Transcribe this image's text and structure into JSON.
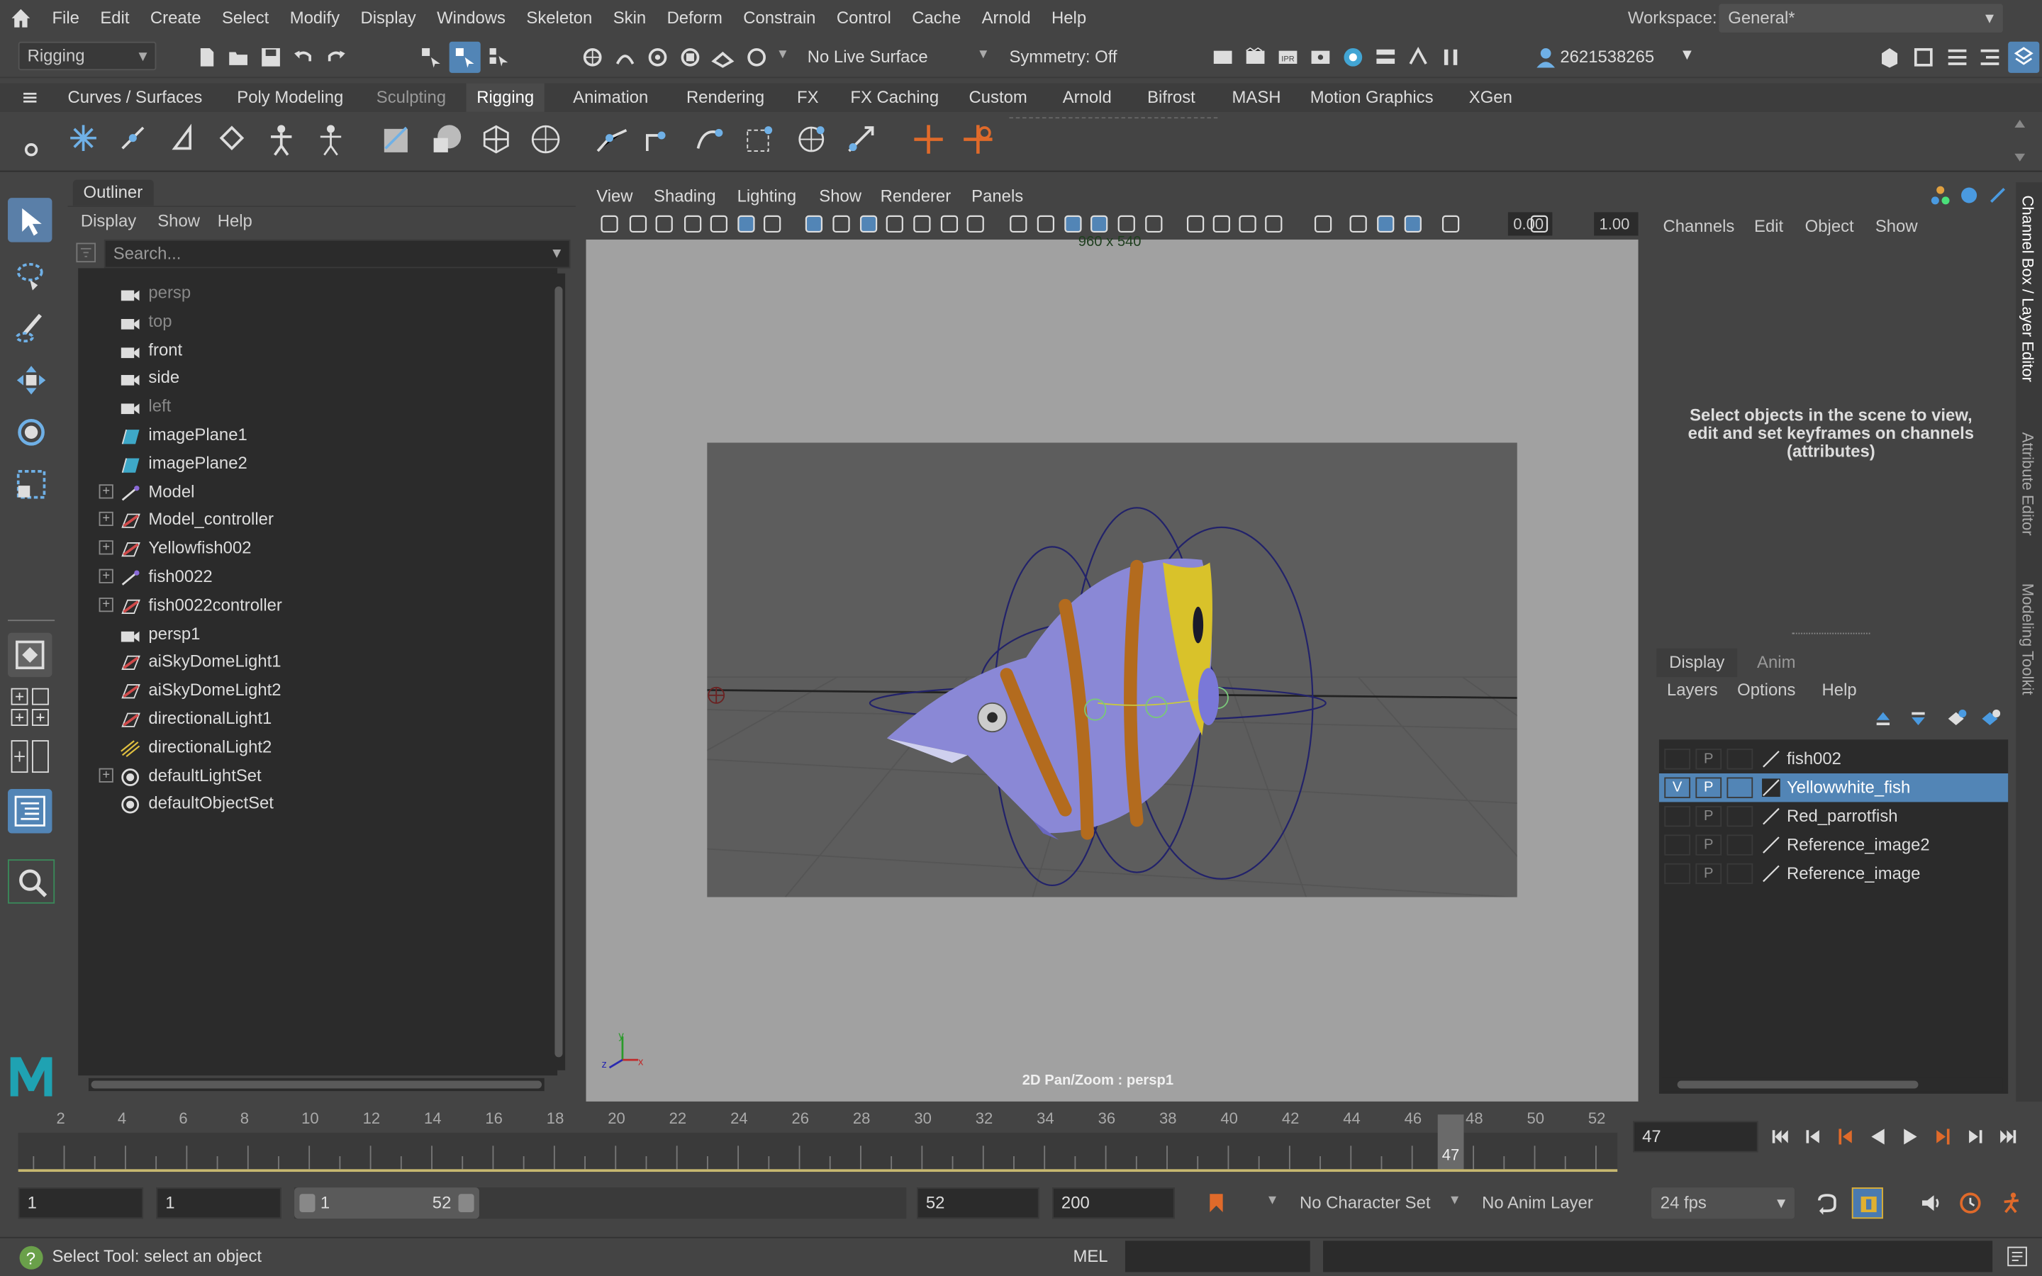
{
  "menubar": {
    "items": [
      "File",
      "Edit",
      "Create",
      "Select",
      "Modify",
      "Display",
      "Windows",
      "Skeleton",
      "Skin",
      "Deform",
      "Constrain",
      "Control",
      "Cache",
      "Arnold",
      "Help"
    ],
    "workspace_label": "Workspace:",
    "workspace_value": "General*"
  },
  "toolbar": {
    "mode": "Rigging",
    "live_surface": "No Live Surface",
    "symmetry": "Symmetry: Off",
    "user_id": "2621538265"
  },
  "shelf": {
    "tabs": [
      "Curves / Surfaces",
      "Poly Modeling",
      "Sculpting",
      "Rigging",
      "Animation",
      "Rendering",
      "FX",
      "FX Caching",
      "Custom",
      "Arnold",
      "Bifrost",
      "MASH",
      "Motion Graphics",
      "XGen"
    ],
    "active_tab": "Rigging"
  },
  "outliner": {
    "title": "Outliner",
    "menu": [
      "Display",
      "Show",
      "Help"
    ],
    "search_placeholder": "Search...",
    "items": [
      {
        "label": "persp",
        "icon": "camera-icon",
        "expandable": false,
        "grey": true
      },
      {
        "label": "top",
        "icon": "camera-icon",
        "expandable": false,
        "grey": true
      },
      {
        "label": "front",
        "icon": "camera-icon",
        "expandable": false,
        "grey": false
      },
      {
        "label": "side",
        "icon": "camera-icon",
        "expandable": false,
        "grey": false
      },
      {
        "label": "left",
        "icon": "camera-icon",
        "expandable": false,
        "grey": true
      },
      {
        "label": "imagePlane1",
        "icon": "image-plane-icon",
        "expandable": false,
        "grey": false
      },
      {
        "label": "imagePlane2",
        "icon": "image-plane-icon",
        "expandable": false,
        "grey": false
      },
      {
        "label": "Model",
        "icon": "joint-icon",
        "expandable": true,
        "grey": false
      },
      {
        "label": "Model_controller",
        "icon": "curve-icon",
        "expandable": true,
        "grey": false
      },
      {
        "label": "Yellowfish002",
        "icon": "curve-icon",
        "expandable": true,
        "grey": false
      },
      {
        "label": "fish0022",
        "icon": "joint-icon",
        "expandable": true,
        "grey": false
      },
      {
        "label": "fish0022controller",
        "icon": "curve-icon",
        "expandable": true,
        "grey": false
      },
      {
        "label": "persp1",
        "icon": "camera-icon",
        "expandable": false,
        "grey": false
      },
      {
        "label": "aiSkyDomeLight1",
        "icon": "curve-icon",
        "expandable": false,
        "grey": false
      },
      {
        "label": "aiSkyDomeLight2",
        "icon": "curve-icon",
        "expandable": false,
        "grey": false
      },
      {
        "label": "directionalLight1",
        "icon": "curve-icon",
        "expandable": false,
        "grey": false
      },
      {
        "label": "directionalLight2",
        "icon": "directional-light-icon",
        "expandable": false,
        "grey": false
      },
      {
        "label": "defaultLightSet",
        "icon": "set-icon",
        "expandable": true,
        "grey": false
      },
      {
        "label": "defaultObjectSet",
        "icon": "set-icon",
        "expandable": false,
        "grey": false
      }
    ]
  },
  "viewport": {
    "menu": [
      "View",
      "Shading",
      "Lighting",
      "Show",
      "Renderer",
      "Panels"
    ],
    "resolution": "960 x 540",
    "exposure": "0.00",
    "gamma": "1.00",
    "camera_label": "2D Pan/Zoom : persp1"
  },
  "channelbox": {
    "menu": [
      "Channels",
      "Edit",
      "Object",
      "Show"
    ],
    "hint": "Select objects in the scene to view, edit and set keyframes on channels (attributes)",
    "side_tabs": [
      "Channel Box / Layer Editor",
      "Attribute Editor",
      "Modeling Toolkit"
    ],
    "layer_tabs": [
      "Display",
      "Anim"
    ],
    "layer_menu": [
      "Layers",
      "Options",
      "Help"
    ],
    "layers": [
      {
        "name": "fish002",
        "v": "",
        "p": "P",
        "selected": false
      },
      {
        "name": "Yellowwhite_fish",
        "v": "V",
        "p": "P",
        "selected": true
      },
      {
        "name": "Red_parrotfish",
        "v": "",
        "p": "P",
        "selected": false
      },
      {
        "name": "Reference_image2",
        "v": "",
        "p": "P",
        "selected": false
      },
      {
        "name": "Reference_image",
        "v": "",
        "p": "P",
        "selected": false
      }
    ]
  },
  "timeline": {
    "ticks": [
      "2",
      "4",
      "6",
      "8",
      "10",
      "12",
      "14",
      "16",
      "18",
      "20",
      "22",
      "24",
      "26",
      "28",
      "30",
      "32",
      "34",
      "36",
      "38",
      "40",
      "42",
      "44",
      "46",
      "48",
      "50",
      "52"
    ],
    "current_frame": "47",
    "current_frame_field": "47"
  },
  "range": {
    "start": "1",
    "playback_start": "1",
    "slider_start": "1",
    "slider_end": "52",
    "playback_end": "52",
    "end": "200",
    "character_set": "No Character Set",
    "anim_layer": "No Anim Layer",
    "fps": "24 fps"
  },
  "status": {
    "help_text": "Select Tool: select an object",
    "command_lang": "MEL"
  },
  "colors": {
    "accent": "#5285b6",
    "panel_bg": "#444444",
    "field_bg": "#2b2b2b",
    "viewport_bg": "#a1a1a1"
  }
}
